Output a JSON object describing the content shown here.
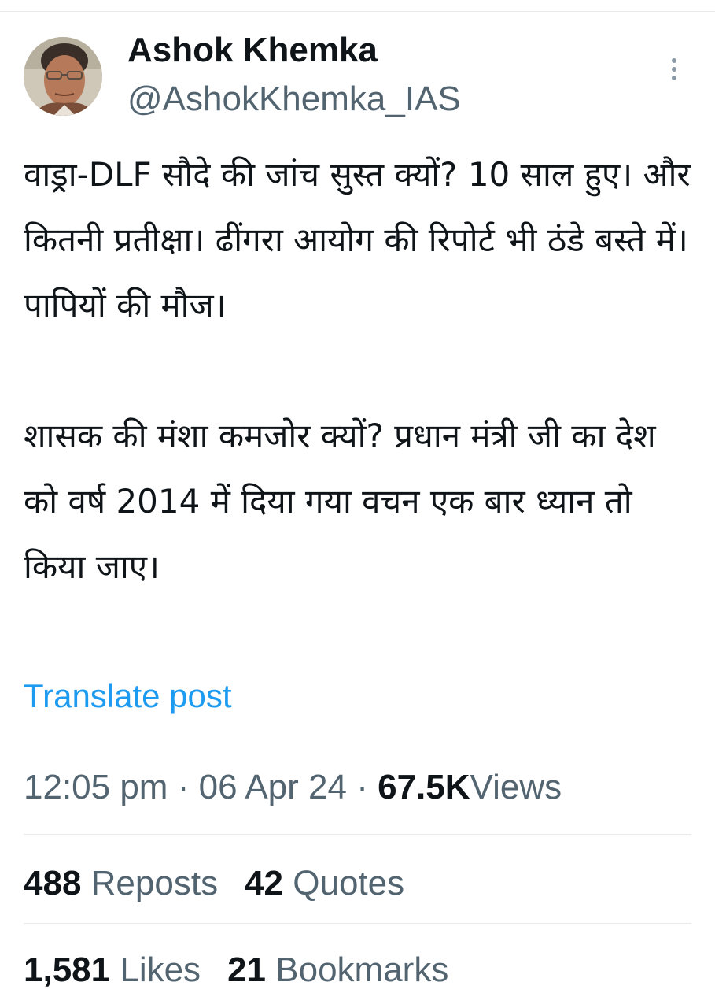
{
  "author": {
    "display_name": "Ashok Khemka",
    "handle": "@AshokKhemka_IAS"
  },
  "tweet": {
    "paragraphs": [
      "वाड्रा-DLF सौदे की जांच सुस्त क्यों? 10 साल हुए। और कितनी प्रतीक्षा। ढींगरा आयोग की रिपोर्ट भी ठंडे बस्ते में। पापियों की मौज।",
      "शासक की मंशा कमजोर क्यों? प्रधान मंत्री जी का देश को वर्ष 2014 में दिया गया वचन एक बार ध्यान तो किया जाए।"
    ],
    "translate_label": "Translate post"
  },
  "meta": {
    "time": "12:05 pm",
    "separator": "·",
    "date": "06 Apr 24",
    "views_count": "67.5K",
    "views_label": "Views"
  },
  "stats": {
    "reposts": {
      "count": "488",
      "label": "Reposts"
    },
    "quotes": {
      "count": "42",
      "label": "Quotes"
    },
    "likes": {
      "count": "1,581",
      "label": "Likes"
    },
    "bookmarks": {
      "count": "21",
      "label": "Bookmarks"
    }
  },
  "icons": {
    "more": "more-vertical-icon"
  },
  "colors": {
    "link": "#1d9bf0",
    "secondary_text": "#536471",
    "primary_text": "#0f1419",
    "divider": "#e7e9ea"
  }
}
